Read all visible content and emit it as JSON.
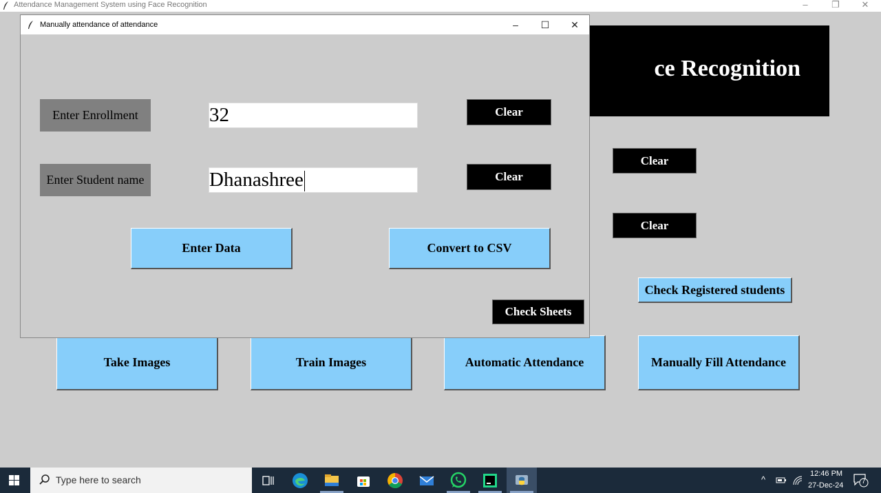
{
  "main_window": {
    "title": "Attendance Management System using Face Recognition",
    "minimize": "–",
    "restore": "❐",
    "close": "✕",
    "banner_text": "ce Recognition",
    "clear_button_1": "Clear",
    "clear_button_2": "Clear",
    "check_registered_label": "Check Registered students",
    "take_images_label": "Take Images",
    "train_images_label": "Train Images",
    "automatic_attendance_label": "Automatic Attendance",
    "manually_fill_label": "Manually Fill Attendance"
  },
  "dialog": {
    "title": "Manually attendance of attendance",
    "minimize": "–",
    "maximize": "☐",
    "close": "✕",
    "enrollment_label": "Enter Enrollment",
    "enrollment_value": "32",
    "student_name_label": "Enter Student name",
    "student_name_value": "Dhanashree",
    "clear_enrollment_label": "Clear",
    "clear_name_label": "Clear",
    "enter_data_label": "Enter Data",
    "convert_csv_label": "Convert to CSV",
    "check_sheets_label": "Check Sheets"
  },
  "taskbar": {
    "search_placeholder": "Type here to search",
    "time": "12:46 PM",
    "date": "27-Dec-24",
    "notification_count": "7",
    "icons": [
      "windows-start-icon",
      "task-view-icon",
      "edge-icon",
      "file-explorer-icon",
      "store-icon",
      "chrome-icon",
      "mail-icon",
      "whatsapp-icon",
      "pycharm-icon",
      "python-icon"
    ]
  },
  "colors": {
    "background": "#cccccc",
    "blue_button": "#87cefa",
    "black_button": "#000000",
    "gray_label": "#808080",
    "taskbar": "#1b2a3a"
  }
}
